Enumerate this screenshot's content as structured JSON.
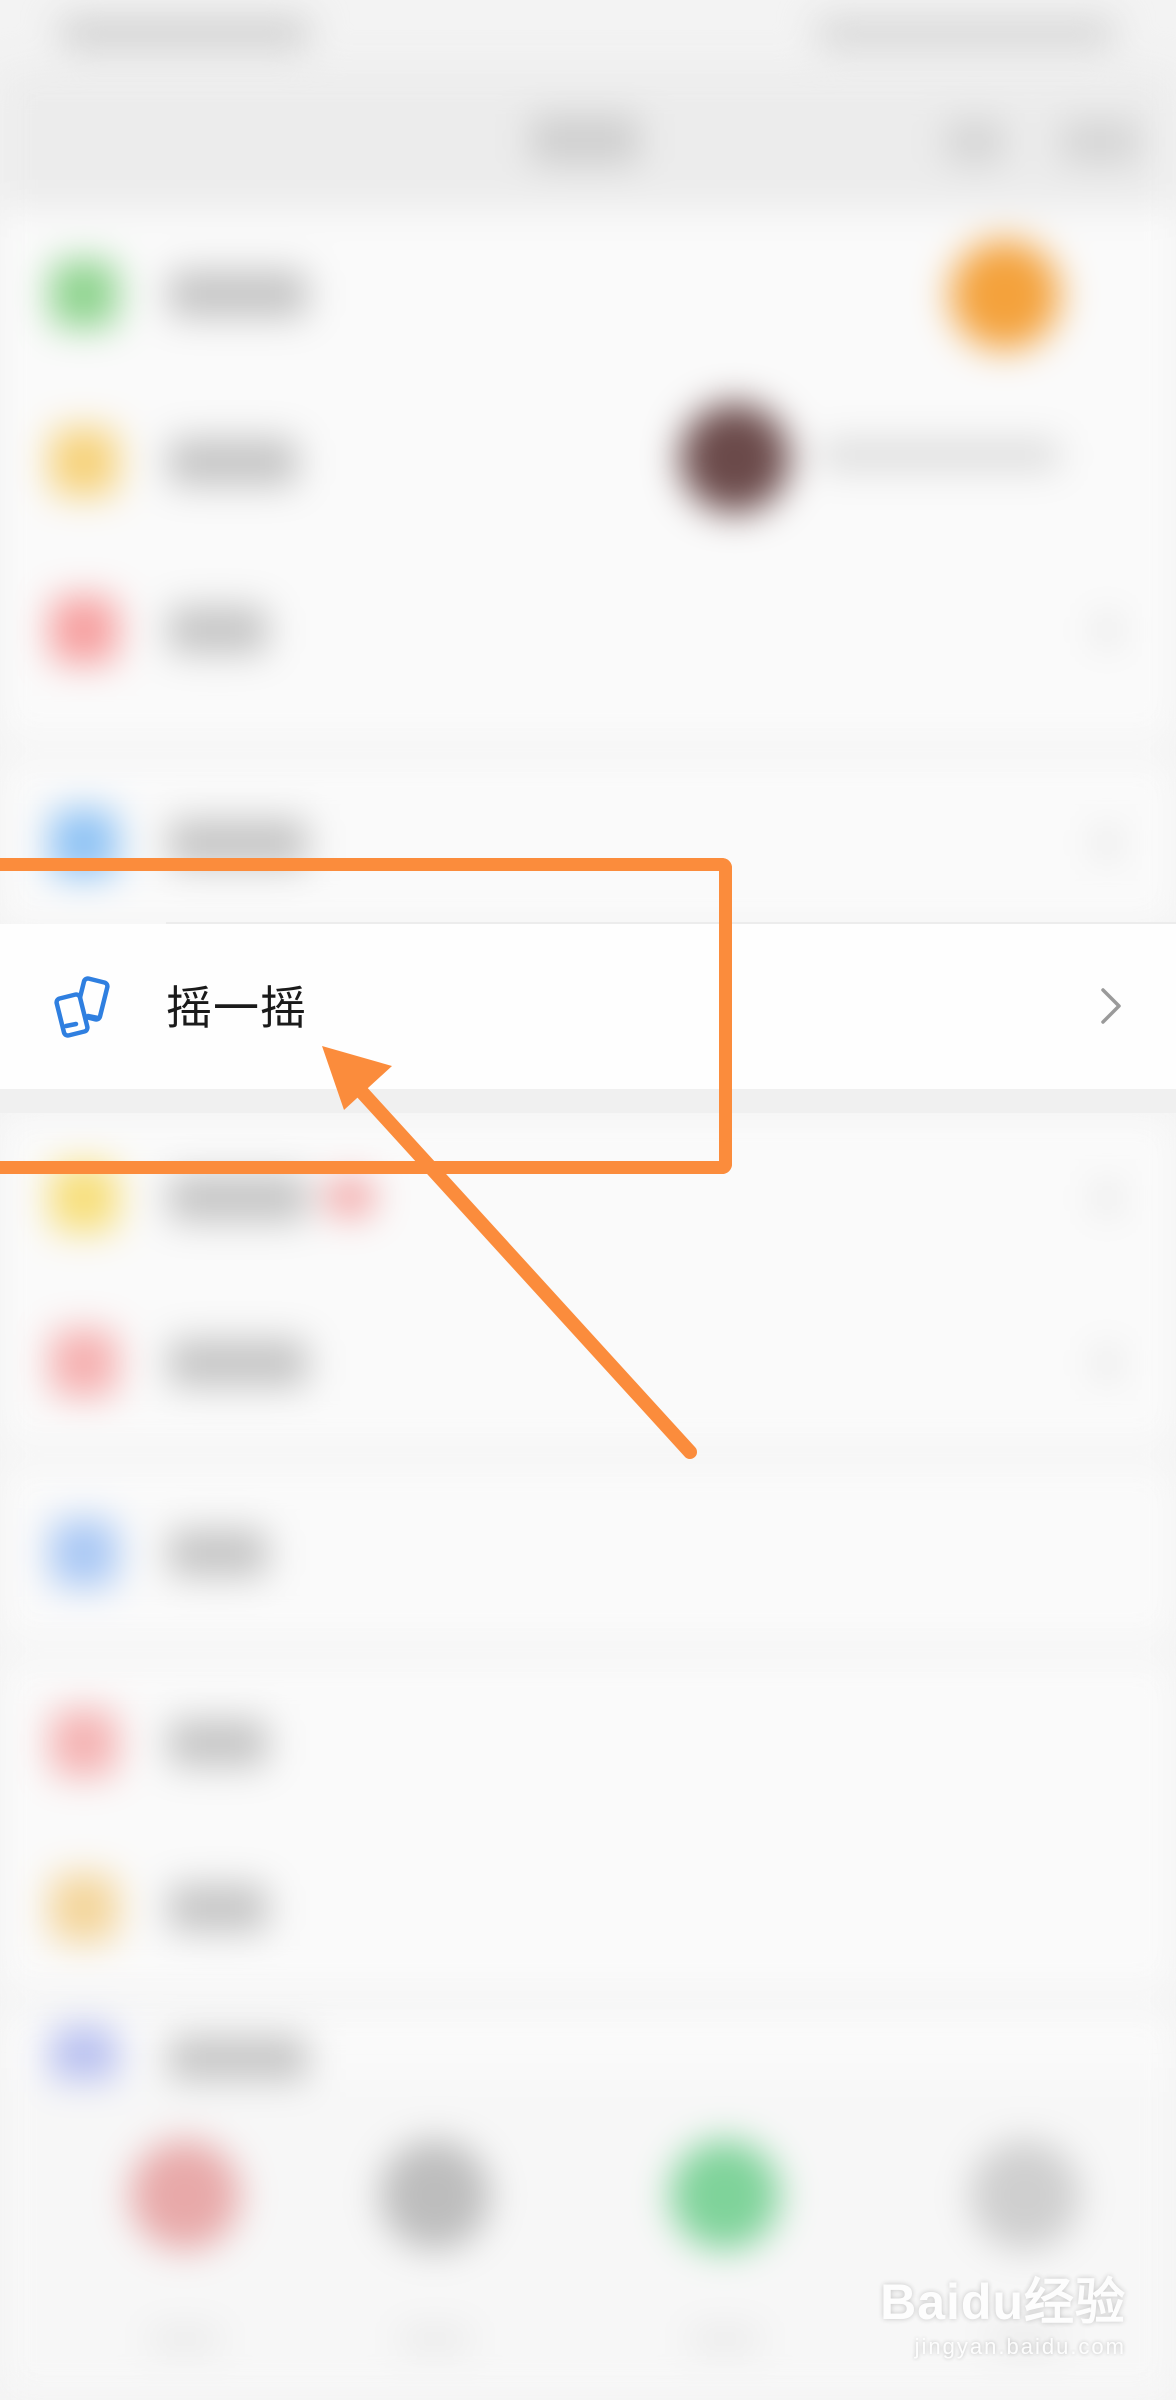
{
  "screen": {
    "highlighted_item": {
      "label": "摇一摇",
      "icon": "shake-phones-icon",
      "chevron": "chevron-right-icon"
    },
    "annotation": {
      "box_color": "#fb8c3c",
      "arrow_color": "#fb8c3c"
    },
    "blurred_list": {
      "note_only_placeholders": true
    },
    "tab_bar": {
      "tabs": [
        "tab-1",
        "tab-2",
        "tab-3",
        "tab-4"
      ]
    }
  },
  "watermark": {
    "brand": "Baidu经验",
    "url": "jingyan.baidu.com"
  },
  "colors": {
    "accent_blue": "#2f7fe0",
    "annotation_orange": "#fb8c3c"
  }
}
